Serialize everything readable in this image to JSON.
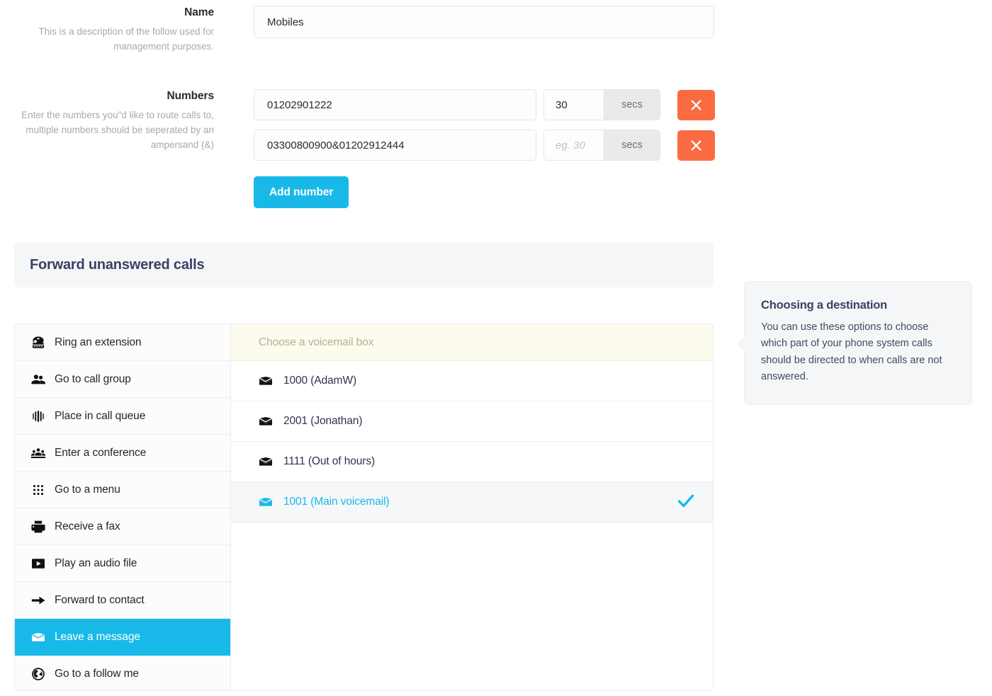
{
  "form": {
    "name_field": {
      "label": "Name",
      "help": "This is a description of the follow used for management purposes.",
      "value": "Mobiles",
      "placeholder": ""
    },
    "numbers_field": {
      "label": "Numbers",
      "help": "Enter the numbers you\"d like to route calls to, multiple numbers should be seperated by an ampersand (&)",
      "secs_suffix": "secs",
      "rows": [
        {
          "number": "01202901222",
          "number_placeholder": "",
          "secs": "30",
          "secs_placeholder": "eg. 30",
          "remove_label": "×"
        },
        {
          "number": "03300800900&01202912444",
          "number_placeholder": "",
          "secs": "",
          "secs_placeholder": "eg. 30",
          "remove_label": "×"
        }
      ],
      "add_button": "Add number"
    }
  },
  "section": {
    "title": "Forward unanswered calls"
  },
  "chooser": {
    "options": [
      {
        "label": "Ring an extension",
        "icon": "telephone-icon",
        "selected": false
      },
      {
        "label": "Go to call group",
        "icon": "users-icon",
        "selected": false
      },
      {
        "label": "Place in call queue",
        "icon": "call-queue-icon",
        "selected": false
      },
      {
        "label": "Enter a conference",
        "icon": "conference-icon",
        "selected": false
      },
      {
        "label": "Go to a menu",
        "icon": "keypad-icon",
        "selected": false
      },
      {
        "label": "Receive a fax",
        "icon": "fax-icon",
        "selected": false
      },
      {
        "label": "Play an audio file",
        "icon": "play-icon",
        "selected": false
      },
      {
        "label": "Forward to contact",
        "icon": "arrow-right-icon",
        "selected": false
      },
      {
        "label": "Leave a message",
        "icon": "envelope-icon",
        "selected": true
      },
      {
        "label": "Go to a follow me",
        "icon": "globe-icon",
        "selected": false
      }
    ],
    "values_header": "Choose a voicemail box",
    "values": [
      {
        "label": "1000 (AdamW)",
        "icon": "envelope-icon",
        "checked": false
      },
      {
        "label": "2001 (Jonathan)",
        "icon": "envelope-icon",
        "checked": false
      },
      {
        "label": "1111 (Out of hours)",
        "icon": "envelope-icon",
        "checked": false
      },
      {
        "label": "1001 (Main voicemail)",
        "icon": "envelope-icon",
        "checked": true
      }
    ]
  },
  "help": {
    "title": "Choosing a destination",
    "body": "You can use these options to choose which part of your phone system calls should be directed to when calls are not answered."
  },
  "colors": {
    "accent_blue": "#18b9e8",
    "danger_orange": "#fa6b42",
    "heading_navy": "#3b3f63",
    "panel_grey": "#f5f6f8",
    "values_header_cream": "#fcfbee"
  }
}
